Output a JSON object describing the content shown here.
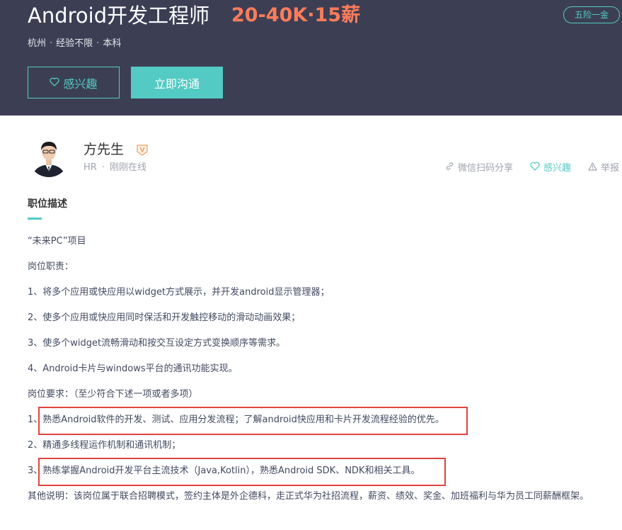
{
  "job": {
    "title": "Android开发工程师",
    "salary": "20-40K·15薪",
    "welfare_tag": "五险一金",
    "city": "杭州",
    "experience": "经验不限",
    "degree": "本科",
    "meta_separator": "·",
    "interest_button": "感兴趣",
    "chat_button": "立即沟通"
  },
  "recruiter": {
    "name": "方先生",
    "title": "HR",
    "separator": "·",
    "status": "刚刚在线"
  },
  "actions": {
    "share": "微信扫码分享",
    "interest": "感兴趣",
    "report": "举报"
  },
  "description": {
    "section_title": "职位描述",
    "lines": [
      "“未来PC”项目",
      "岗位职责：",
      "1、将多个应用或快应用以widget方式展示，并开发android显示管理器；",
      "2、使多个应用或快应用同时保活和开发触控移动的滑动动画效果；",
      "3、使多个widget流畅滑动和按交互设定方式变换顺序等需求。",
      "4、Android卡片与windows平台的通讯功能实现。",
      "岗位要求：（至少符合下述一项或者多项）",
      "1、熟悉Android软件的开发、测试、应用分发流程；了解android快应用和卡片开发流程经验的优先。",
      "2、精通多线程运作机制和通讯机制；",
      "3、熟练掌握Android开发平台主流技术（Java,Kotlin），熟悉Android SDK、NDK和相关工具。",
      "其他说明：该岗位属于联合招聘模式，签约主体是外企德科，走正式华为社招流程，薪资、绩效、奖金、加班福利与华为员工同薪酬框架。"
    ]
  },
  "colors": {
    "banner": "#3c3f54",
    "accent": "#53cac3",
    "salary": "#ff7c5a",
    "highlight_box": "#e0443e"
  },
  "icons": {
    "heart": "heart-icon",
    "link": "link-icon",
    "warning": "warning-icon",
    "verified": "verified-v-icon"
  }
}
